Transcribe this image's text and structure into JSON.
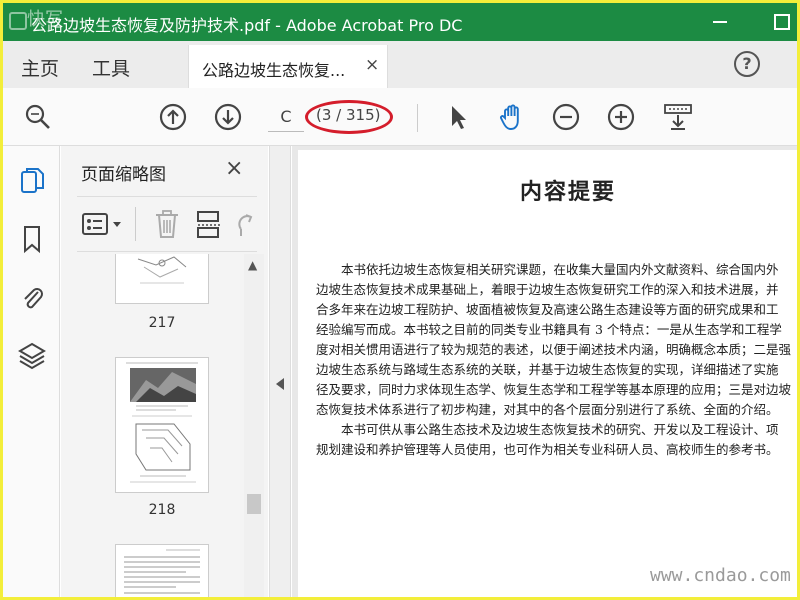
{
  "window": {
    "title": "公路边坡生态恢复及防护技术.pdf - Adobe Acrobat Pro DC",
    "top_watermark": "快写"
  },
  "menubar": {
    "home_label": "主页",
    "tools_label": "工具",
    "doc_tab_label": "公路边坡生态恢复...",
    "doc_tab_close": "×",
    "help": "?"
  },
  "toolbar": {
    "page_input_value": "C",
    "page_count": "(3 / 315)",
    "icons": [
      "magnifier-icon",
      "prev-page-icon",
      "next-page-icon",
      "select-arrow-icon",
      "hand-icon",
      "zoom-out-icon",
      "zoom-in-icon",
      "scroll-mode-icon"
    ]
  },
  "rail": {
    "icons": [
      "page-thumbnails-icon",
      "bookmark-icon",
      "attachment-icon",
      "layers-icon"
    ]
  },
  "panel": {
    "title": "页面缩略图",
    "close": "×",
    "thumbnails": [
      {
        "label": "217"
      },
      {
        "label": "218"
      }
    ]
  },
  "document": {
    "heading": "内容提要",
    "paragraphs": [
      "　　本书依托边坡生态恢复相关研究课题，在收集大量国内外文献资料、综合国内外",
      "边坡生态恢复技术成果基础上，着眼于边坡生态恢复研究工作的深入和技术进展，并",
      "合多年来在边坡工程防护、坡面植被恢复及高速公路生态建设等方面的研究成果和工",
      "经验编写而成。本书较之目前的同类专业书籍具有 3 个特点：一是从生态学和工程学",
      "度对相关惯用语进行了较为规范的表述，以便于阐述技术内涵，明确概念本质；二是强",
      "边坡生态系统与路域生态系统的关联，并基于边坡生态恢复的实现，详细描述了实施",
      "径及要求，同时力求体现生态学、恢复生态学和工程学等基本原理的应用；三是对边坡",
      "态恢复技术体系进行了初步构建，对其中的各个层面分别进行了系统、全面的介绍。",
      "　　本书可供从事公路生态技术及边坡生态恢复技术的研究、开发以及工程设计、项",
      "规划建设和养护管理等人员使用，也可作为相关专业科研人员、高校师生的参考书。"
    ]
  },
  "bottom_watermark": "www.cndao.com",
  "colors": {
    "titlebar": "#1c8b43",
    "highlight_ellipse": "#d41d2b",
    "frame": "#f3ee3a",
    "active_blue": "#1b73c9"
  }
}
